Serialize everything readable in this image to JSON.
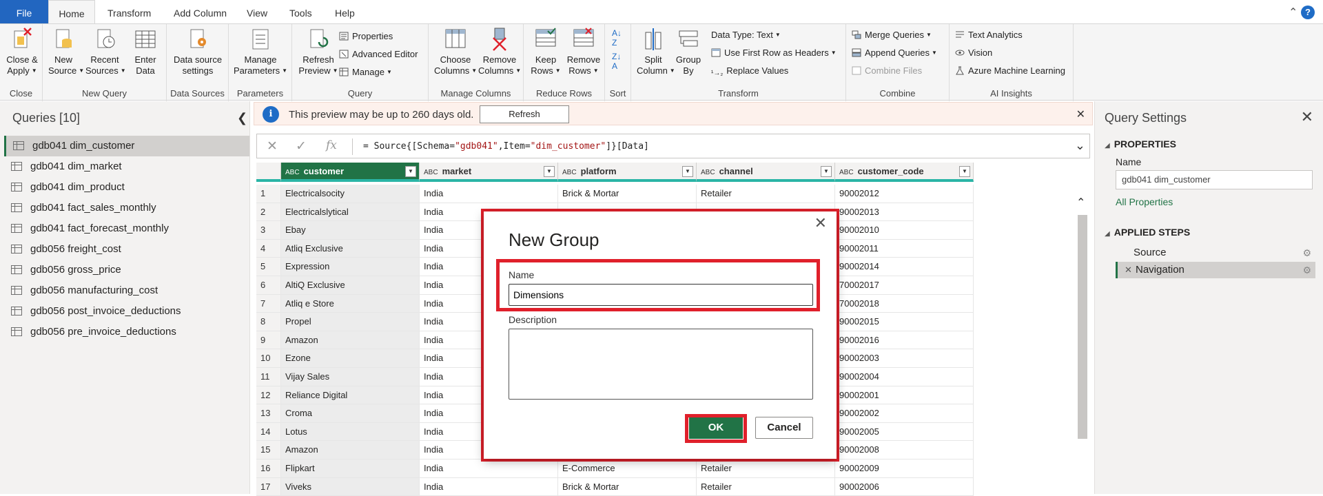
{
  "menu": {
    "tabs": [
      "File",
      "Home",
      "Transform",
      "Add Column",
      "View",
      "Tools",
      "Help"
    ],
    "active": "Home",
    "help_icon": "?"
  },
  "ribbon": {
    "groups": {
      "close": {
        "name": "Close",
        "close_apply": "Close & Apply"
      },
      "new_query": {
        "name": "New Query",
        "new_source": "New Source",
        "recent_sources": "Recent Sources",
        "enter_data": "Enter Data"
      },
      "data_sources": {
        "name": "Data Sources",
        "settings": "Data source settings"
      },
      "parameters": {
        "name": "Parameters",
        "manage": "Manage Parameters"
      },
      "query": {
        "name": "Query",
        "refresh_preview": "Refresh Preview",
        "properties": "Properties",
        "advanced_editor": "Advanced Editor",
        "manage": "Manage"
      },
      "manage_columns": {
        "name": "Manage Columns",
        "choose": "Choose Columns",
        "remove": "Remove Columns"
      },
      "reduce_rows": {
        "name": "Reduce Rows",
        "keep": "Keep Rows",
        "remove": "Remove Rows"
      },
      "sort": {
        "name": "Sort"
      },
      "transform": {
        "name": "Transform",
        "split": "Split Column",
        "group_by": "Group By",
        "data_type": "Data Type: Text",
        "first_row": "Use First Row as Headers",
        "replace": "Replace Values"
      },
      "combine": {
        "name": "Combine",
        "merge": "Merge Queries",
        "append": "Append Queries",
        "combine_files": "Combine Files"
      },
      "ai": {
        "name": "AI Insights",
        "text_analytics": "Text Analytics",
        "vision": "Vision",
        "azure_ml": "Azure Machine Learning"
      }
    }
  },
  "queries": {
    "title": "Queries [10]",
    "items": [
      "gdb041 dim_customer",
      "gdb041 dim_market",
      "gdb041 dim_product",
      "gdb041 fact_sales_monthly",
      "gdb041 fact_forecast_monthly",
      "gdb056 freight_cost",
      "gdb056 gross_price",
      "gdb056 manufacturing_cost",
      "gdb056 post_invoice_deductions",
      "gdb056 pre_invoice_deductions"
    ],
    "selected_index": 0
  },
  "infobar": {
    "message": "This preview may be up to 260 days old.",
    "button": "Refresh"
  },
  "formula": {
    "prefix": "= Source{[Schema=",
    "schema": "\"gdb041\"",
    "mid": ",Item=",
    "item": "\"dim_customer\"",
    "suffix": "]}[Data]"
  },
  "grid": {
    "type_label": "ABC",
    "columns": [
      "customer",
      "market",
      "platform",
      "channel",
      "customer_code"
    ],
    "rows": [
      [
        "1",
        "Electricalsocity",
        "India",
        "Brick & Mortar",
        "Retailer",
        "90002012"
      ],
      [
        "2",
        "Electricalslytical",
        "India",
        "",
        "",
        "90002013"
      ],
      [
        "3",
        "Ebay",
        "India",
        "",
        "",
        "90002010"
      ],
      [
        "4",
        "Atliq Exclusive",
        "India",
        "",
        "",
        "90002011"
      ],
      [
        "5",
        "Expression",
        "India",
        "",
        "",
        "90002014"
      ],
      [
        "6",
        "AltiQ Exclusive",
        "India",
        "",
        "",
        "70002017"
      ],
      [
        "7",
        "Atliq e Store",
        "India",
        "",
        "",
        "70002018"
      ],
      [
        "8",
        "Propel",
        "India",
        "",
        "",
        "90002015"
      ],
      [
        "9",
        "Amazon",
        "India",
        "",
        "",
        "90002016"
      ],
      [
        "10",
        "Ezone",
        "India",
        "",
        "",
        "90002003"
      ],
      [
        "11",
        "Vijay Sales",
        "India",
        "",
        "",
        "90002004"
      ],
      [
        "12",
        "Reliance Digital",
        "India",
        "",
        "",
        "90002001"
      ],
      [
        "13",
        "Croma",
        "India",
        "",
        "",
        "90002002"
      ],
      [
        "14",
        "Lotus",
        "India",
        "",
        "",
        "90002005"
      ],
      [
        "15",
        "Amazon",
        "India",
        "",
        "",
        "90002008"
      ],
      [
        "16",
        "Flipkart",
        "India",
        "E-Commerce",
        "Retailer",
        "90002009"
      ],
      [
        "17",
        "Viveks",
        "India",
        "Brick & Mortar",
        "Retailer",
        "90002006"
      ]
    ]
  },
  "settings": {
    "title": "Query Settings",
    "properties_header": "PROPERTIES",
    "name_label": "Name",
    "name_value": "gdb041 dim_customer",
    "all_properties": "All Properties",
    "steps_header": "APPLIED STEPS",
    "steps": [
      "Source",
      "Navigation"
    ]
  },
  "dialog": {
    "title": "New Group",
    "name_label": "Name",
    "name_value": "Dimensions",
    "description_label": "Description",
    "ok": "OK",
    "cancel": "Cancel"
  },
  "colors": {
    "accent": "#217346",
    "highlight": "#e0202b",
    "file_tab": "#2266c0",
    "info_icon": "#1f6cc6"
  }
}
